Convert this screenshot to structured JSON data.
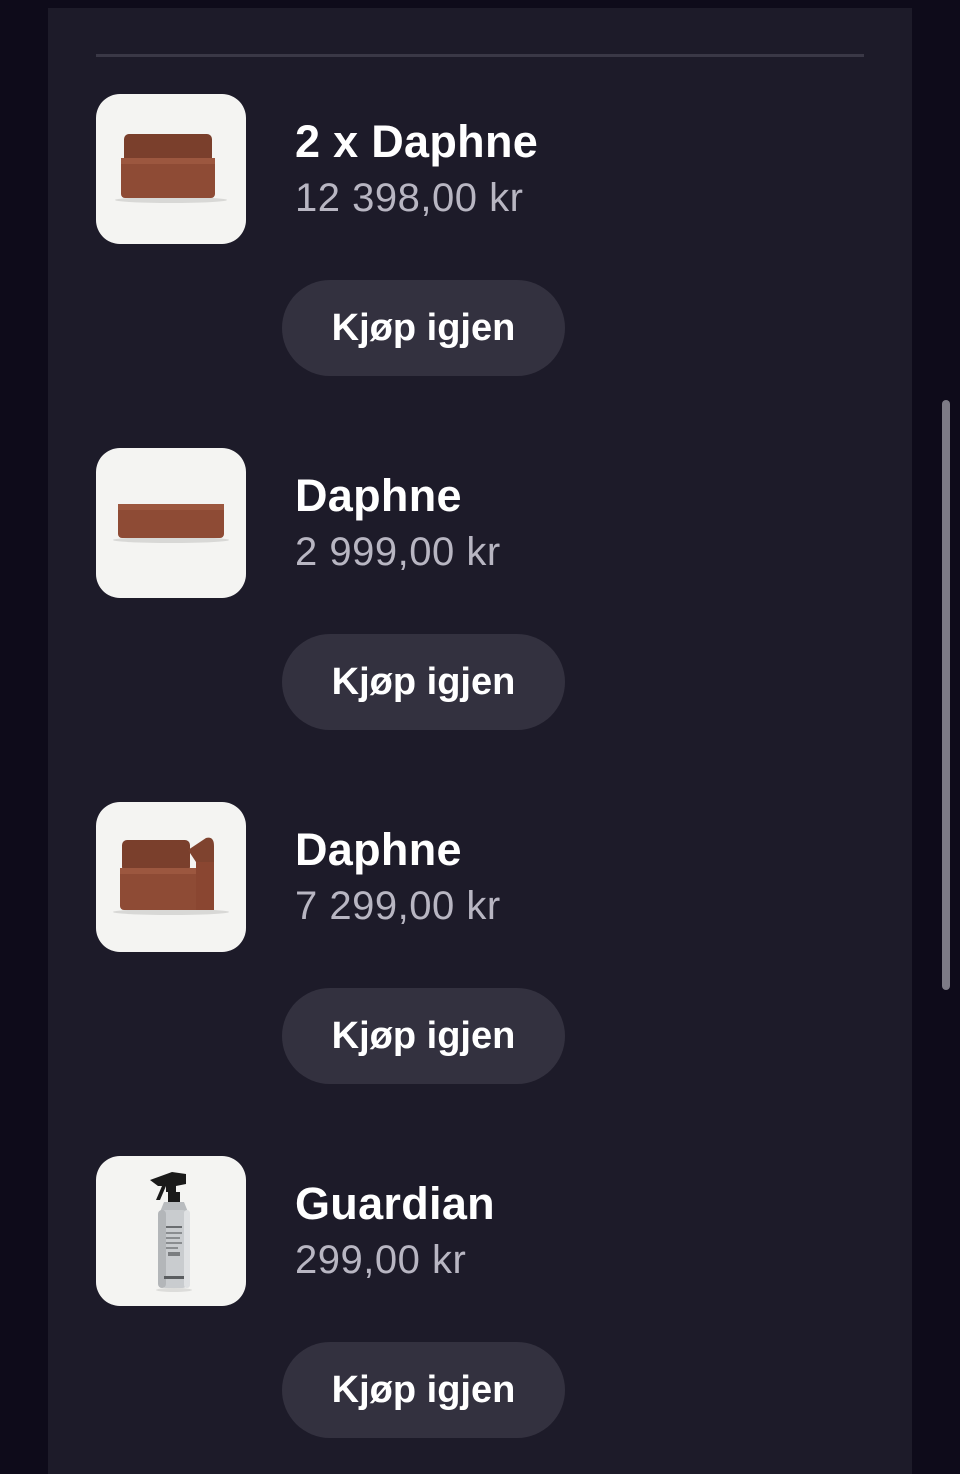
{
  "orders": [
    {
      "name": "2 x Daphne",
      "price": "12 398,00 kr",
      "action": "Kjøp igjen",
      "icon": "sofa-armless-module-image"
    },
    {
      "name": "Daphne",
      "price": "2 999,00 kr",
      "action": "Kjøp igjen",
      "icon": "ottoman-module-image"
    },
    {
      "name": "Daphne",
      "price": "7 299,00 kr",
      "action": "Kjøp igjen",
      "icon": "sofa-corner-module-image"
    },
    {
      "name": "Guardian",
      "price": "299,00 kr",
      "action": "Kjøp igjen",
      "icon": "spray-bottle-image"
    }
  ],
  "colors": {
    "background": "#0e0b1a",
    "panel": "#1d1b29",
    "button": "#33313f",
    "price_text": "#b8b6c2",
    "sofa": "#8a4a34"
  }
}
